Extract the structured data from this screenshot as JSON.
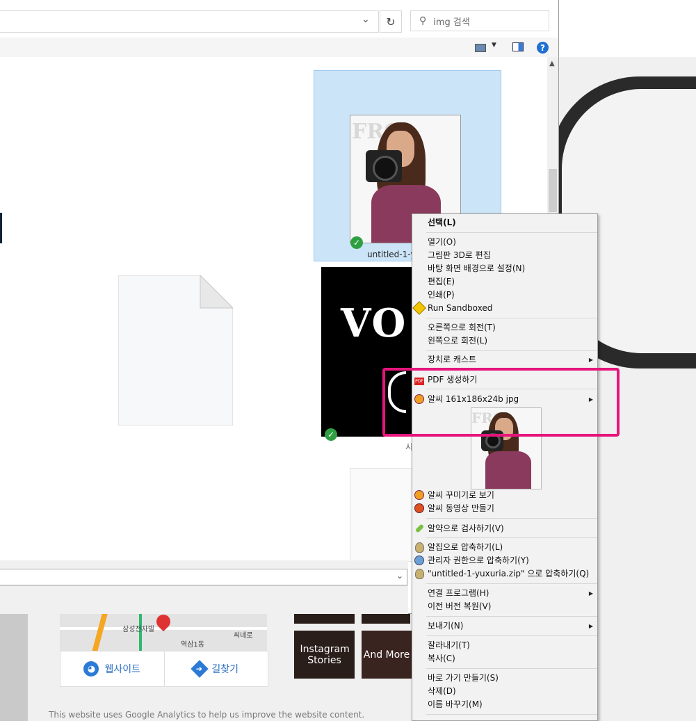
{
  "explorer": {
    "search_placeholder": "img 검색",
    "selected_file": "untitled-1-y",
    "partial_label": "시"
  },
  "context_menu": {
    "items": [
      {
        "label": "선택(L)",
        "bold": true
      },
      {
        "label": "열기(O)"
      },
      {
        "label": "그림판 3D로 편집"
      },
      {
        "label": "바탕 화면 배경으로 설정(N)"
      },
      {
        "label": "편집(E)"
      },
      {
        "label": "인쇄(P)"
      },
      {
        "label": "Run Sandboxed",
        "icon": "sandbox-icon"
      },
      {
        "label": "오른쪽으로 회전(T)"
      },
      {
        "label": "왼쪽으로 회전(L)"
      },
      {
        "label": "장치로 캐스트",
        "submenu": true
      },
      {
        "label": "PDF 생성하기",
        "icon": "pdf-icon"
      },
      {
        "label": "알씨 161x186x24b jpg",
        "icon": "alsee-icon",
        "submenu": true
      },
      {
        "label": "알씨 꾸미기로 보기",
        "icon": "alsee-decorate-icon"
      },
      {
        "label": "알씨 동영상 만들기",
        "icon": "alsee-video-icon"
      },
      {
        "label": "알약으로 검사하기(V)",
        "icon": "alyac-icon"
      },
      {
        "label": "알집으로 압축하기(L)",
        "icon": "alzip-icon"
      },
      {
        "label": "관리자 권한으로 압축하기(Y)",
        "icon": "alzip-admin-icon"
      },
      {
        "label": "\"untitled-1-yuxuria.zip\" 으로 압축하기(Q)",
        "icon": "alzip-icon"
      },
      {
        "label": "연결 프로그램(H)",
        "submenu": true
      },
      {
        "label": "이전 버전 복원(V)"
      },
      {
        "label": "보내기(N)",
        "submenu": true
      },
      {
        "label": "잘라내기(T)"
      },
      {
        "label": "복사(C)"
      },
      {
        "label": "바로 가기 만들기(S)"
      },
      {
        "label": "삭제(D)"
      },
      {
        "label": "이름 바꾸기(M)"
      }
    ]
  },
  "background_page": {
    "map_labels": [
      "삼성전자빌",
      "역삼1동",
      "씨네로"
    ],
    "website_button": "웹사이트",
    "directions_button": "길찾기",
    "tiles": [
      "Instagram Stories",
      "And More"
    ],
    "analytics_notice": "This website uses Google Analytics to help us improve the website content."
  },
  "colors": {
    "highlight": "#e6157c",
    "selection": "#cce4f7",
    "check": "#2ea043"
  }
}
